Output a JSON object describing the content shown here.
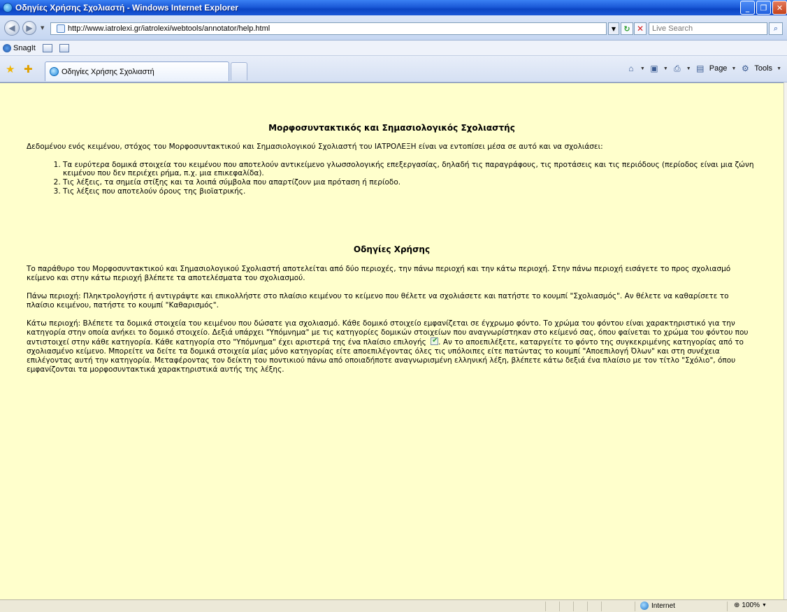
{
  "window": {
    "title": "Οδηγίες Χρήσης Σχολιαστή - Windows Internet Explorer",
    "buttons": {
      "minimize": "_",
      "maximize": "❐",
      "close": "✕"
    }
  },
  "address_bar": {
    "url": "http://www.iatrolexi.gr/iatrolexi/webtools/annotator/help.html",
    "search_placeholder": "Live Search"
  },
  "links_bar": {
    "snagit_label": "SnagIt"
  },
  "tabs": {
    "active_tab_label": "Οδηγίες Χρήσης Σχολιαστή"
  },
  "command_bar": {
    "page_label": "Page",
    "tools_label": "Tools"
  },
  "document": {
    "title": "Μορφοσυντακτικός και Σημασιολογικός Σχολιαστής",
    "intro": "Δεδομένου ενός κειμένου, στόχος του Μορφοσυντακτικού και Σημασιολογικού Σχολιαστή του ΙΑΤΡΟΛΕΞΗ είναι να εντοπίσει μέσα σε αυτό και να σχολιάσει:",
    "goals": [
      "Τα ευρύτερα δομικά στοιχεία του κειμένου που αποτελούν αντικείμενο γλωσσολογικής επεξεργασίας, δηλαδή τις παραγράφους, τις προτάσεις και τις περιόδους (περίοδος είναι μια ζώνη κειμένου που δεν περιέχει ρήμα, π.χ. μια επικεφαλίδα).",
      "Τις λέξεις, τα σημεία στίξης και τα λοιπά σύμβολα που απαρτίζουν μια πρόταση ή περίοδο.",
      "Τις λέξεις που αποτελούν όρους της βιοϊατρικής."
    ],
    "instructions_title": "Οδηγίες Χρήσης",
    "para_overview": "Το παράθυρο του Μορφοσυντακτικού και Σημασιολογικού Σχολιαστή αποτελείται από δύο περιοχές, την πάνω περιοχή και την κάτω περιοχή. Στην πάνω περιοχή εισάγετε το προς σχολιασμό κείμενο και στην κάτω περιοχή βλέπετε τα αποτελέσματα του σχολιασμού.",
    "para_top": "Πάνω περιοχή: Πληκτρολογήστε ή αντιγράψτε και επικολλήστε στο πλαίσιο κειμένου το κείμενο που θέλετε να σχολιάσετε και πατήστε το κουμπί \"Σχολιασμός\". Αν θέλετε να καθαρίσετε το πλαίσιο κειμένου, πατήστε το κουμπί \"Καθαρισμός\".",
    "para_bottom_a": "Κάτω περιοχή: Βλέπετε τα δομικά στοιχεία του κειμένου που δώσατε για σχολιασμό. Κάθε δομικό στοιχείο εμφανίζεται σε έγχρωμο φόντο. Το χρώμα του φόντου είναι χαρακτηριστικό για την κατηγορία στην οποία ανήκει το δομικό στοιχείο. Δεξιά υπάρχει \"Υπόμνημα\" με τις κατηγορίες δομικών στοιχείων που αναγνωρίστηκαν στο κείμενό σας, όπου φαίνεται το χρώμα του φόντου που αντιστοιχεί στην κάθε κατηγορία. Κάθε κατηγορία στο \"Υπόμνημα\" έχει αριστερά της ένα πλαίσιο επιλογής",
    "para_bottom_b": ". Αν το αποεπιλέξετε, καταργείτε το φόντο της συγκεκριμένης κατηγορίας από το σχολιασμένο κείμενο. Μπορείτε να δείτε τα δομικά στοιχεία μίας μόνο κατηγορίας είτε αποεπιλέγοντας όλες τις υπόλοιπες είτε πατώντας το κουμπί \"Αποεπιλογή Όλων\" και στη συνέχεια επιλέγοντας αυτή την κατηγορία. Μεταφέροντας τον δείκτη του ποντικιού πάνω από οποιαδήποτε αναγνωρισμένη ελληνική λέξη, βλέπετε κάτω δεξιά ένα πλαίσιο με τον τίτλο \"Σχόλιο\", όπου εμφανίζονται τα μορφοσυντακτικά χαρακτηριστικά αυτής της λέξης."
  },
  "status_bar": {
    "zone": "Internet",
    "zoom": "100%"
  },
  "colors": {
    "page_background": "#ffffcc",
    "titlebar": "#1c5ad8"
  }
}
